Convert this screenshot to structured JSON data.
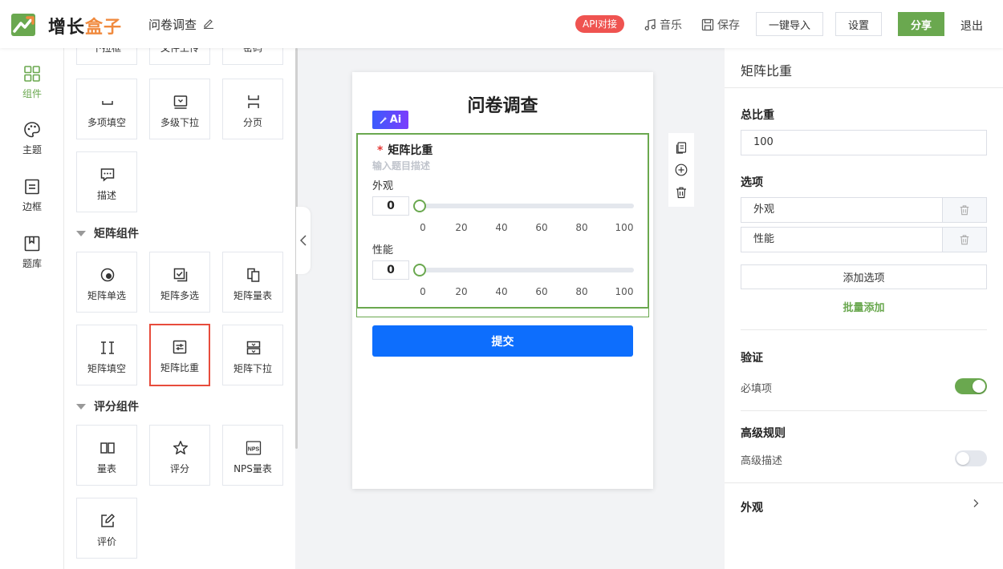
{
  "header": {
    "brand_a": "增长",
    "brand_b": "盒子",
    "doc_title": "问卷调查",
    "api_badge": "API对接",
    "music": "音乐",
    "save": "保存",
    "import": "一键导入",
    "settings": "设置",
    "share": "分享",
    "logout": "退出"
  },
  "rail": [
    {
      "label": "组件",
      "icon": "grid-icon",
      "active": true
    },
    {
      "label": "主题",
      "icon": "palette-icon",
      "active": false
    },
    {
      "label": "边框",
      "icon": "border-icon",
      "active": false
    },
    {
      "label": "题库",
      "icon": "library-icon",
      "active": false
    }
  ],
  "palette": {
    "top_partial": [
      "下拉框",
      "文件上传",
      "密码"
    ],
    "basic_row": [
      "多项填空",
      "多级下拉",
      "分页"
    ],
    "describe": "描述",
    "matrix_section": "矩阵组件",
    "matrix_row1": [
      "矩阵单选",
      "矩阵多选",
      "矩阵量表"
    ],
    "matrix_row2": [
      "矩阵填空",
      "矩阵比重",
      "矩阵下拉"
    ],
    "rating_section": "评分组件",
    "rating_row": [
      "量表",
      "评分",
      "NPS量表"
    ],
    "nps_glyph": "NPS",
    "evaluate": "评价"
  },
  "form": {
    "title": "问卷调查",
    "ai_badge": "Ai",
    "question": {
      "required_mark": "*",
      "title": "矩阵比重",
      "description_placeholder": "输入题目描述",
      "options": [
        {
          "label": "外观",
          "value": 0
        },
        {
          "label": "性能",
          "value": 0
        }
      ],
      "ticks": [
        "0",
        "20",
        "40",
        "60",
        "80",
        "100"
      ]
    },
    "submit": "提交"
  },
  "right_panel": {
    "title": "矩阵比重",
    "total_label": "总比重",
    "total_value": "100",
    "options_label": "选项",
    "options": [
      "外观",
      "性能"
    ],
    "add_option": "添加选项",
    "batch_add": "批量添加",
    "validation_label": "验证",
    "required_label": "必填项",
    "required_on": true,
    "advanced_label": "高级规则",
    "advanced_desc_label": "高级描述",
    "advanced_desc_on": false,
    "appearance_label": "外观"
  },
  "colors": {
    "accent": "#6aa84f",
    "submit": "#0d6efd",
    "api": "#ef5350",
    "selected_border": "#e74c3c"
  }
}
